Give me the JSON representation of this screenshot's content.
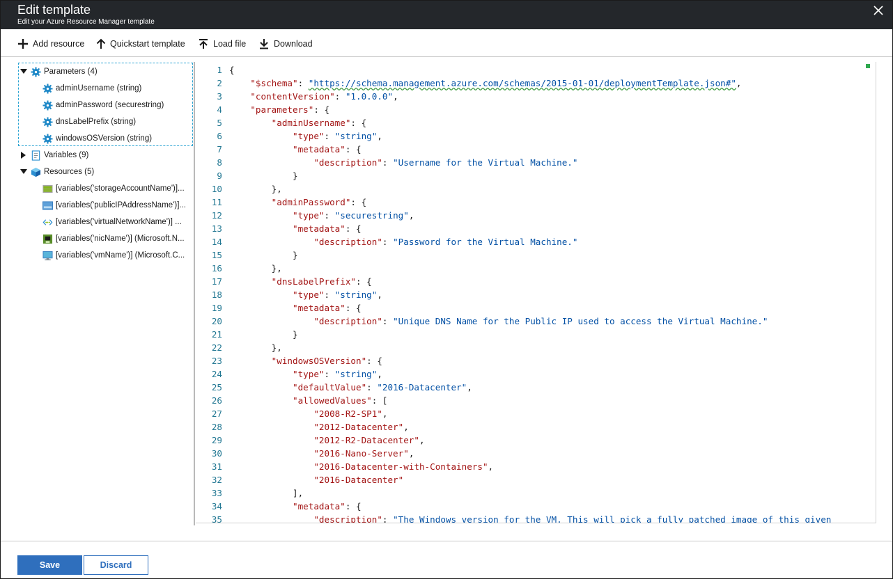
{
  "header": {
    "title": "Edit template",
    "subtitle": "Edit your Azure Resource Manager template",
    "close_icon": "close-icon"
  },
  "toolbar": {
    "add_resource": "Add resource",
    "quickstart_template": "Quickstart template",
    "load_file": "Load file",
    "download": "Download"
  },
  "tree": {
    "parameters": {
      "label": "Parameters (4)",
      "children": [
        "adminUsername (string)",
        "adminPassword (securestring)",
        "dnsLabelPrefix (string)",
        "windowsOSVersion (string)"
      ]
    },
    "variables": {
      "label": "Variables (9)"
    },
    "resources": {
      "label": "Resources (5)",
      "children": [
        "[variables('storageAccountName')]...",
        "[variables('publicIPAddressName')]...",
        "[variables('virtualNetworkName')] ...",
        "[variables('nicName')] (Microsoft.N...",
        "[variables('vmName')] (Microsoft.C..."
      ]
    }
  },
  "editor": {
    "lines": [
      "1",
      "2",
      "3",
      "4",
      "5",
      "6",
      "7",
      "8",
      "9",
      "10",
      "11",
      "12",
      "13",
      "14",
      "15",
      "16",
      "17",
      "18",
      "19",
      "20",
      "21",
      "22",
      "23",
      "24",
      "25",
      "26",
      "27",
      "28",
      "29",
      "30",
      "31",
      "32",
      "33",
      "34",
      "35"
    ],
    "schema_key": "\"$schema\"",
    "schema_url": "\"https://schema.management.azure.com/schemas/2015-01-01/deploymentTemplate.json#\"",
    "content_version_key": "\"contentVersion\"",
    "content_version_val": "\"1.0.0.0\"",
    "parameters_key": "\"parameters\"",
    "admin_username_key": "\"adminUsername\"",
    "type_key": "\"type\"",
    "string_val": "\"string\"",
    "metadata_key": "\"metadata\"",
    "description_key": "\"description\"",
    "desc_username": "\"Username for the Virtual Machine.\"",
    "admin_password_key": "\"adminPassword\"",
    "securestring_val": "\"securestring\"",
    "desc_password": "\"Password for the Virtual Machine.\"",
    "dns_label_key": "\"dnsLabelPrefix\"",
    "desc_dns": "\"Unique DNS Name for the Public IP used to access the Virtual Machine.\"",
    "windows_os_key": "\"windowsOSVersion\"",
    "default_value_key": "\"defaultValue\"",
    "default_value_val": "\"2016-Datacenter\"",
    "allowed_values_key": "\"allowedValues\"",
    "allowed_values": [
      "\"2008-R2-SP1\"",
      "\"2012-Datacenter\"",
      "\"2012-R2-Datacenter\"",
      "\"2016-Nano-Server\"",
      "\"2016-Datacenter-with-Containers\"",
      "\"2016-Datacenter\""
    ],
    "desc_windows_partial": "\"The Windows version for the VM. This will pick a fully patched image of this given"
  },
  "footer": {
    "save": "Save",
    "discard": "Discard"
  },
  "colors": {
    "header_bg": "#24272b",
    "primary_blue": "#2f6fbd",
    "key_red": "#a31515",
    "string_blue": "#0451a5",
    "line_number": "#237893"
  }
}
